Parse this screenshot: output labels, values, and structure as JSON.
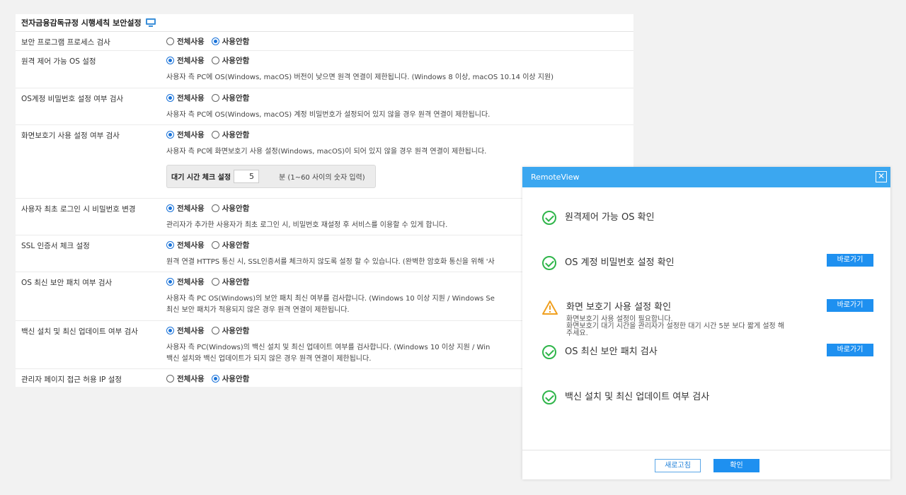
{
  "settings": {
    "title": "전자금융감독규정 시행세칙 보안설정",
    "radio_all": "전체사용",
    "radio_none": "사용안함",
    "rows": [
      {
        "label": "보안 프로그램 프로세스 검사",
        "selected": "none"
      },
      {
        "label": "원격 제어 가능 OS 설정",
        "selected": "all",
        "desc": "사용자 측 PC에 OS(Windows, macOS) 버전이 낮으면 원격 연결이 제한됩니다. (Windows 8 이상, macOS 10.14 이상 지원)"
      },
      {
        "label": "OS계정 비밀번호 설정 여부 검사",
        "selected": "all",
        "desc": "사용자 측 PC에 OS(Windows, macOS) 계정 비밀번호가 설정되어 있지 않을 경우 원격 연결이 제한됩니다."
      },
      {
        "label": "화면보호기 사용 설정 여부 검사",
        "selected": "all",
        "desc": "사용자 측 PC에 화면보호기 사용 설정(Windows, macOS)이 되어 있지 않을 경우 원격 연결이 제한됩니다.",
        "wait_label": "대기 시간 체크 설정",
        "wait_value": "5",
        "wait_unit": "분 (1~60 사이의 숫자 입력)"
      },
      {
        "label": "사용자 최초 로그인 시 비밀번호 변경",
        "selected": "all",
        "desc": "관리자가 추가한 사용자가 최초 로그인 시, 비밀번호 재설정 후 서비스를 이용할 수 있게 합니다."
      },
      {
        "label": "SSL 인증서 체크 설정",
        "selected": "all",
        "desc": "원격 연결 HTTPS 통신 시, SSL인증서를 체크하지 않도록 설정 할 수 있습니다. (완벽한 암호화 통신을 위해 '사"
      },
      {
        "label": "OS 최신 보안 패치 여부 검사",
        "selected": "all",
        "desc": "사용자 측 PC OS(Windows)의 보안 패치 최신 여부를 검사합니다. (Windows 10 이상 지원 / Windows Se",
        "desc2": "최신 보안 패치가 적용되지 않은 경우 원격 연결이 제한됩니다."
      },
      {
        "label": "백신 설치 및 최신 업데이트 여부 검사",
        "selected": "all",
        "desc": "사용자 측 PC(Windows)의 백신 설치 및 최신 업데이트 여부를 검사합니다. (Windows 10 이상 지원 / Win",
        "desc2": "백신 설치와 백신 업데이트가 되지 않은 경우 원격 연결이 제한됩니다."
      },
      {
        "label": "관리자 페이지 접근 허용 IP 설정",
        "selected": "none"
      }
    ]
  },
  "dialog": {
    "title": "RemoteView",
    "close": "✕",
    "items": [
      {
        "label": "원격제어 가능 OS 확인",
        "status": "ok"
      },
      {
        "label": "OS 계정 비밀번호 설정 확인",
        "status": "ok",
        "button": "바로가기"
      },
      {
        "label": "화면 보호기 사용 설정 확인",
        "status": "warn",
        "button": "바로가기",
        "sub1": "화면보호기 사용 설정이 필요합니다.",
        "sub2": "화면보호기 대기 시간을 관리자가 설정한 대기 시간 5분 보다 짧게 설정 해",
        "sub3": "주세요."
      },
      {
        "label": "OS 최신 보안 패치 검사",
        "status": "ok",
        "button": "바로가기"
      },
      {
        "label": "백신 설치 및 최신 업데이트 여부 검사",
        "status": "ok"
      }
    ],
    "refresh": "새로고침",
    "ok": "확인"
  },
  "colors": {
    "accent": "#1e90f0",
    "title_bar": "#3ba7f0",
    "check": "#2fb54a",
    "warn": "#f0a020"
  }
}
